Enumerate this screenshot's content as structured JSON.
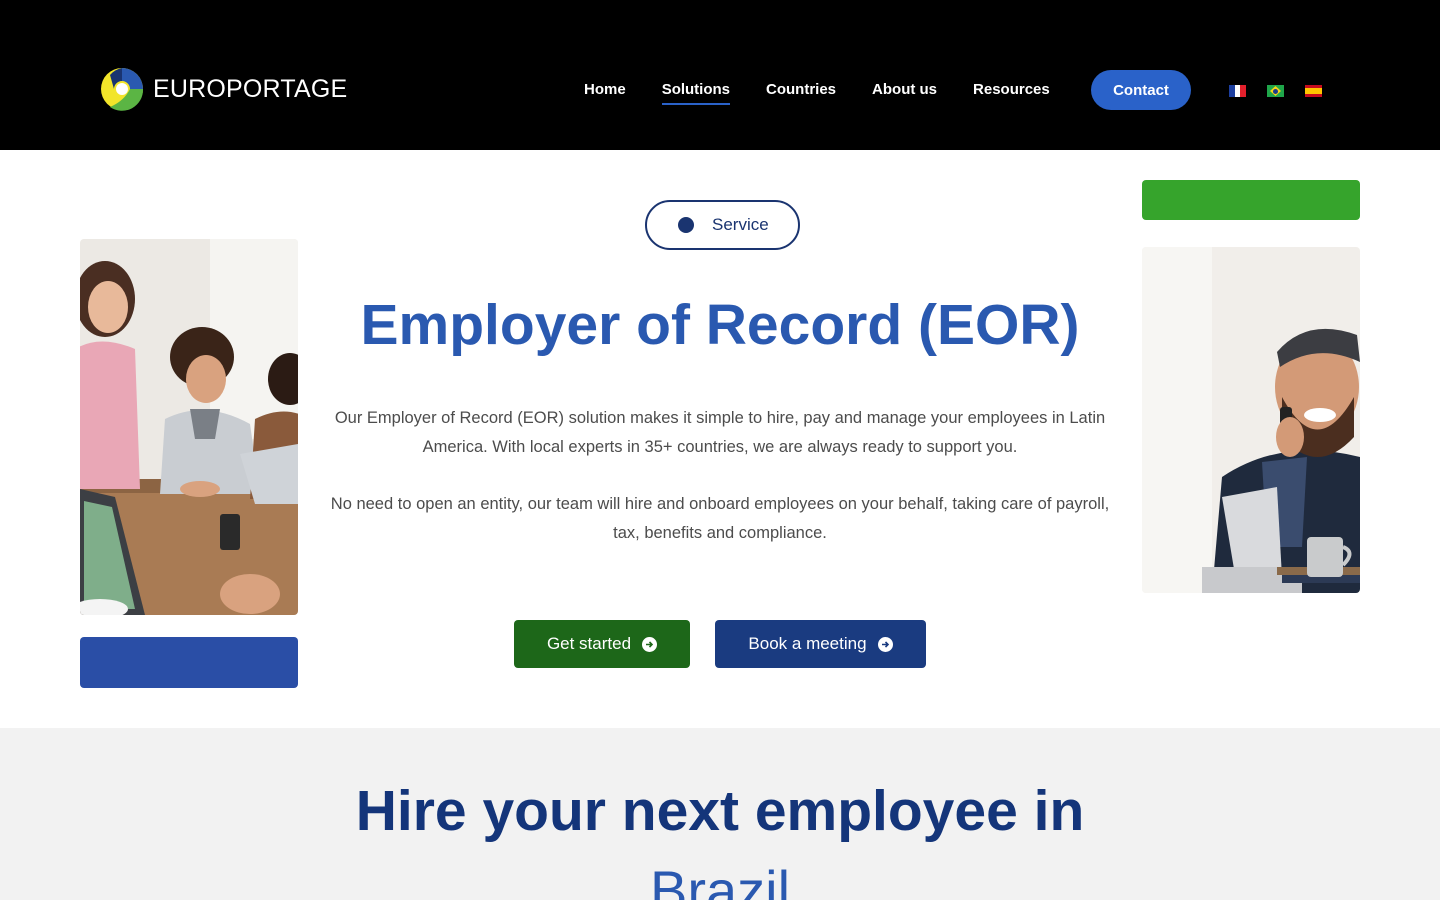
{
  "brand": {
    "name": "EUROPORTAGE",
    "logo_icon": "europortage-logo-icon",
    "colors": {
      "blue": "#2a59b0",
      "navy": "#1a3470",
      "green": "#1d6719",
      "yellow": "#f2e52a"
    }
  },
  "nav": {
    "items": [
      {
        "label": "Home",
        "active": false
      },
      {
        "label": "Solutions",
        "active": true
      },
      {
        "label": "Countries",
        "active": false
      },
      {
        "label": "About us",
        "active": false
      },
      {
        "label": "Resources",
        "active": false
      }
    ],
    "contact_label": "Contact",
    "languages": [
      "French",
      "Portuguese (Brazil)",
      "Spanish"
    ]
  },
  "hero": {
    "badge": "Service",
    "title": "Employer of Record (EOR)",
    "paragraph_1": "Our Employer of Record (EOR) solution makes it simple to hire, pay and manage your employees in Latin America. With local experts in 35+ countries, we are always ready to support you.",
    "paragraph_2": "No need to open an entity, our team will hire and onboard employees on your behalf, taking care of payroll, tax, benefits and compliance.",
    "cta_primary": "Get started",
    "cta_secondary": "Book a meeting",
    "cta_icon": "arrow-circle-right-icon"
  },
  "hire": {
    "title": "Hire your next employee in",
    "country": "Brazil"
  }
}
